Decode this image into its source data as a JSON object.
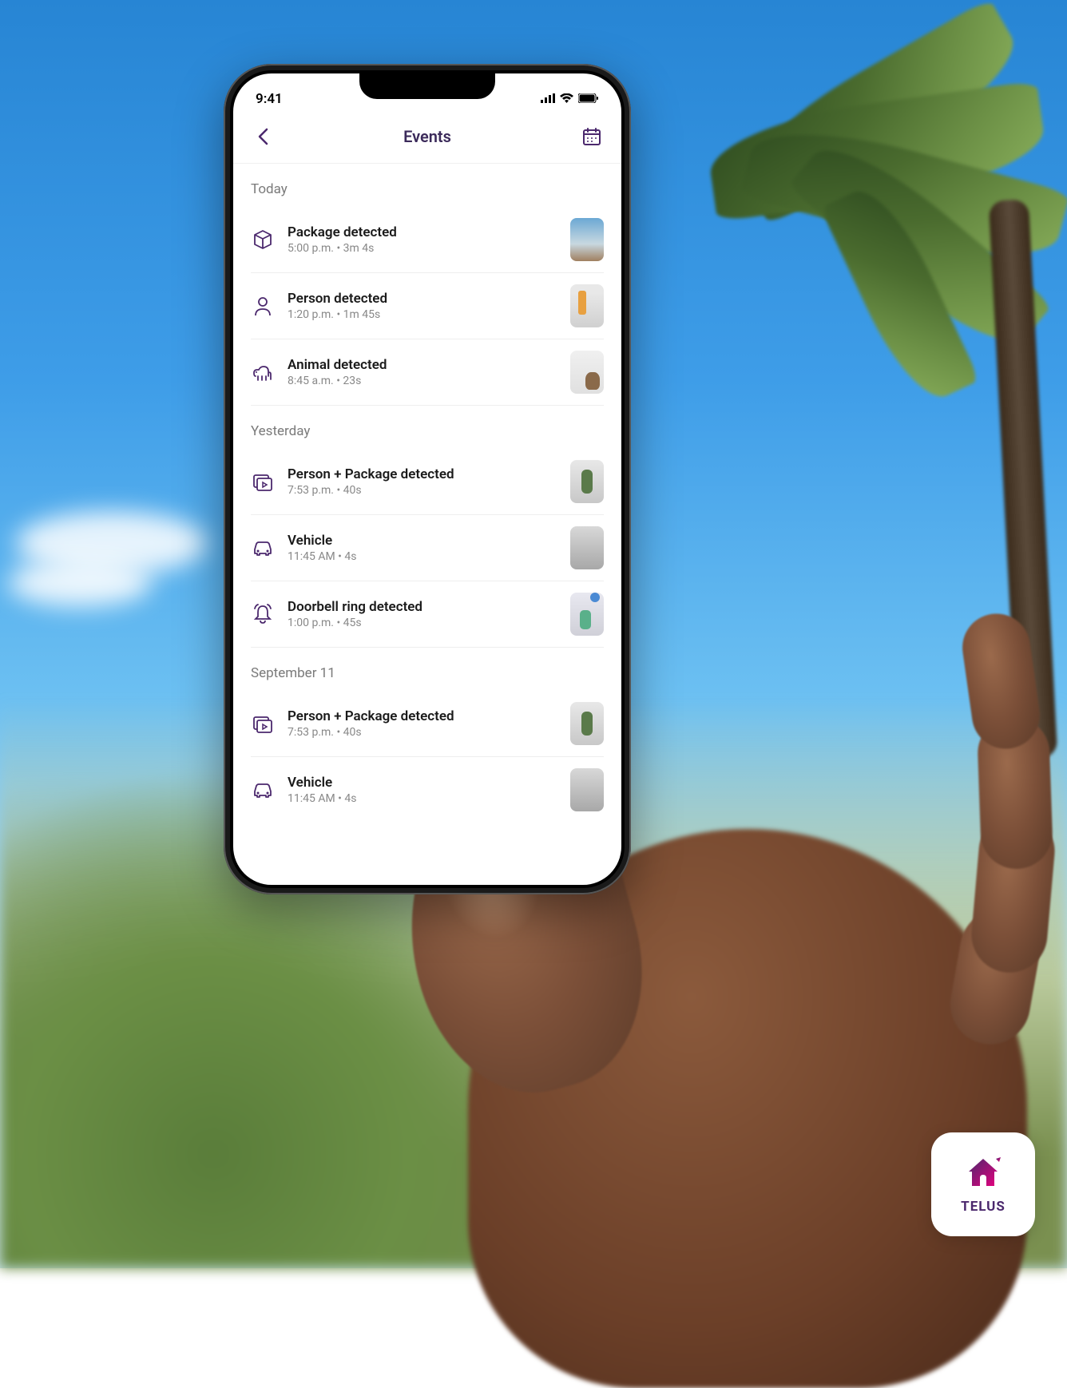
{
  "status_bar": {
    "time": "9:41"
  },
  "header": {
    "title": "Events"
  },
  "sections": [
    {
      "label": "Today",
      "events": [
        {
          "title": "Package detected",
          "sub": "5:00 p.m. • 3m 4s",
          "icon": "package"
        },
        {
          "title": "Person detected",
          "sub": "1:20 p.m. • 1m 45s",
          "icon": "person"
        },
        {
          "title": "Animal detected",
          "sub": "8:45 a.m. • 23s",
          "icon": "animal"
        }
      ]
    },
    {
      "label": "Yesterday",
      "events": [
        {
          "title": "Person + Package detected",
          "sub": "7:53 p.m. • 40s",
          "icon": "video"
        },
        {
          "title": "Vehicle",
          "sub": "11:45 AM • 4s",
          "icon": "vehicle"
        },
        {
          "title": "Doorbell ring detected",
          "sub": "1:00 p.m. • 45s",
          "icon": "bell"
        }
      ]
    },
    {
      "label": "September 11",
      "events": [
        {
          "title": "Person + Package detected",
          "sub": "7:53 p.m. • 40s",
          "icon": "video"
        },
        {
          "title": "Vehicle",
          "sub": "11:45 AM • 4s",
          "icon": "vehicle"
        }
      ]
    }
  ],
  "badge": {
    "text": "TELUS"
  },
  "colors": {
    "brand": "#4b286d"
  }
}
